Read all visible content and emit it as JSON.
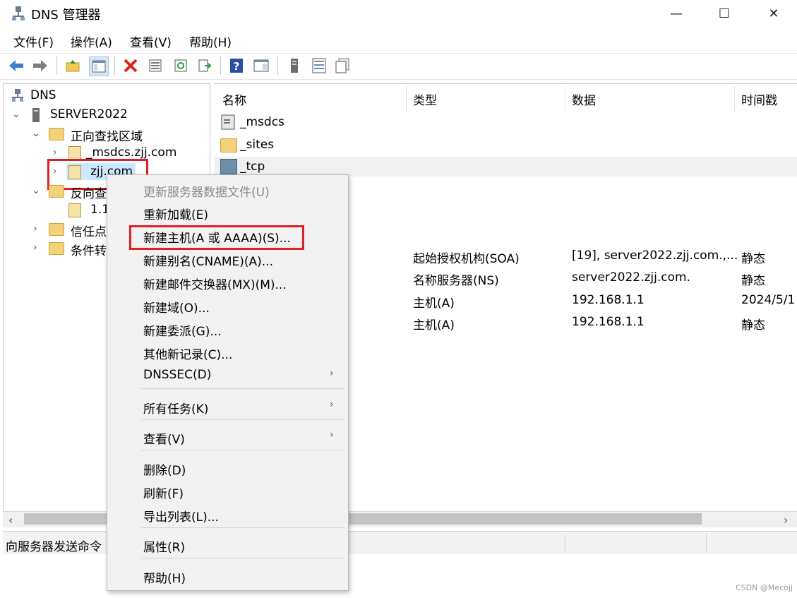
{
  "window": {
    "title": "DNS 管理器",
    "minimize": "—",
    "maximize": "☐",
    "close": "✕"
  },
  "menu": [
    "文件(F)",
    "操作(A)",
    "查看(V)",
    "帮助(H)"
  ],
  "toolbar": [
    "back-icon",
    "forward-icon",
    "up-folder-icon",
    "show-hide-tree-icon",
    "delete-icon",
    "properties-icon",
    "refresh-icon",
    "export-list-icon",
    "help-icon",
    "action-pane-icon",
    "server-icon",
    "list-view-icon",
    "detail-view-icon"
  ],
  "tree": {
    "root": "DNS",
    "server": "SERVER2022",
    "forward_zones": "正向查找区域",
    "msdcs_zone": "_msdcs.zjj.com",
    "zjj_zone": "zjj.com",
    "reverse_zones": "反向查",
    "reverse_item": "1.1",
    "trust_points": "信任点",
    "conditional": "条件转"
  },
  "list": {
    "columns": [
      "名称",
      "类型",
      "数据",
      "时间戳"
    ],
    "rows": [
      {
        "name": "_msdcs",
        "type": "",
        "data": "",
        "time": ""
      },
      {
        "name": "_sites",
        "type": "",
        "data": "",
        "time": ""
      },
      {
        "name": "_tcp",
        "type": "",
        "data": "",
        "time": ""
      },
      {
        "name": "",
        "type": "起始授权机构(SOA)",
        "data": "[19], server2022.zjj.com.,...",
        "time": "静态"
      },
      {
        "name": "",
        "type": "名称服务器(NS)",
        "data": "server2022.zjj.com.",
        "time": "静态"
      },
      {
        "name": "",
        "type": "主机(A)",
        "data": "192.168.1.1",
        "time": "2024/5/1"
      },
      {
        "name": "",
        "type": "主机(A)",
        "data": "192.168.1.1",
        "time": "静态"
      }
    ]
  },
  "context_menu": {
    "update_server_file": "更新服务器数据文件(U)",
    "reload": "重新加载(E)",
    "new_host": "新建主机(A 或 AAAA)(S)...",
    "new_alias": "新建别名(CNAME)(A)...",
    "new_mx": "新建邮件交换器(MX)(M)...",
    "new_domain": "新建域(O)...",
    "new_delegation": "新建委派(G)...",
    "other_records": "其他新记录(C)...",
    "dnssec": "DNSSEC(D)",
    "all_tasks": "所有任务(K)",
    "view": "查看(V)",
    "delete": "删除(D)",
    "refresh": "刷新(F)",
    "export_list": "导出列表(L)...",
    "properties": "属性(R)",
    "help": "帮助(H)",
    "submenu_arrow": "›"
  },
  "status": {
    "text": "向服务器发送命令"
  },
  "scroll": {
    "left": "‹",
    "right": "›"
  },
  "watermark": "CSDN @Mecojj",
  "colors": {
    "highlight_red": "#e01f26",
    "selection_blue": "#cce8ff"
  }
}
